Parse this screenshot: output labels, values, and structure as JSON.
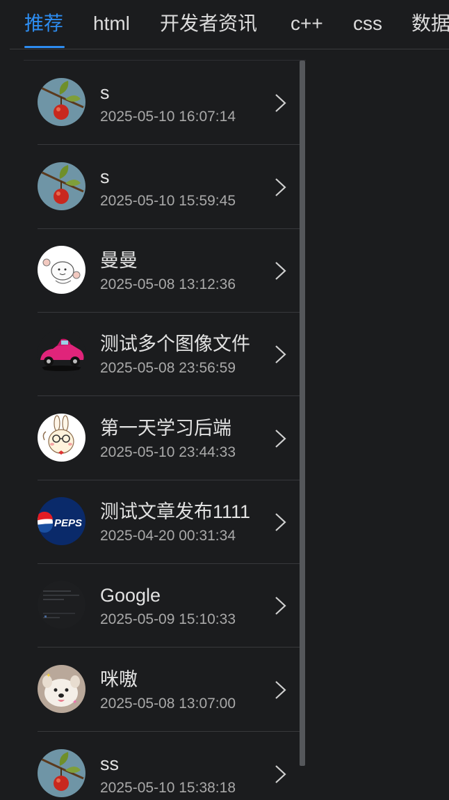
{
  "tabs": [
    {
      "label": "推荐",
      "active": true
    },
    {
      "label": "html",
      "active": false
    },
    {
      "label": "开发者资讯",
      "active": false
    },
    {
      "label": "c++",
      "active": false
    },
    {
      "label": "css",
      "active": false
    },
    {
      "label": "数据",
      "active": false
    }
  ],
  "colors": {
    "background": "#1b1c1e",
    "accent": "#2d8cf0",
    "title_text": "#e2e2e2",
    "date_text": "#a9a9a9"
  },
  "articles": [
    {
      "title": "s",
      "date": "2025-05-10 16:07:14",
      "avatar": "apple-branch"
    },
    {
      "title": "s",
      "date": "2025-05-10 15:59:45",
      "avatar": "apple-branch"
    },
    {
      "title": "曼曼",
      "date": "2025-05-08 13:12:36",
      "avatar": "white-bunny-sticker"
    },
    {
      "title": "测试多个图像文件",
      "date": "2025-05-08 23:56:59",
      "avatar": "pink-car"
    },
    {
      "title": "第一天学习后端",
      "date": "2025-05-10 23:44:33",
      "avatar": "glasses-bunny-sticker"
    },
    {
      "title": "测试文章发布1111",
      "date": "2025-04-20 00:31:34",
      "avatar": "pepsi-logo"
    },
    {
      "title": "Google",
      "date": "2025-05-09 15:10:33",
      "avatar": "dark-screenshot"
    },
    {
      "title": "咪嗷",
      "date": "2025-05-08 13:07:00",
      "avatar": "fluffy-dog"
    },
    {
      "title": "ss",
      "date": "2025-05-10 15:38:18",
      "avatar": "apple-branch"
    }
  ],
  "item_icon": "chevron-right-icon"
}
